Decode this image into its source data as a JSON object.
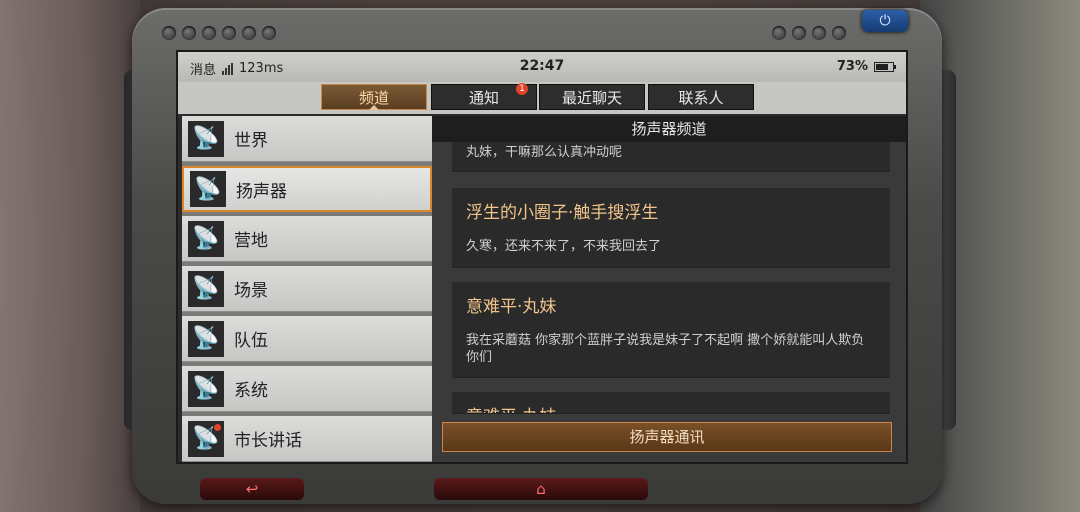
{
  "status_bar": {
    "left_label": "消息",
    "latency": "123ms",
    "time": "22:47",
    "battery": "73%"
  },
  "tabs": [
    {
      "label": "频道",
      "active": true
    },
    {
      "label": "通知",
      "badge": "1"
    },
    {
      "label": "最近聊天"
    },
    {
      "label": "联系人"
    }
  ],
  "channels": [
    {
      "label": "世界"
    },
    {
      "label": "扬声器",
      "active": true
    },
    {
      "label": "营地"
    },
    {
      "label": "场景"
    },
    {
      "label": "队伍"
    },
    {
      "label": "系统"
    },
    {
      "label": "市长讲话",
      "notification": true
    }
  ],
  "chat": {
    "title": "扬声器频道",
    "messages": [
      {
        "name": "",
        "text": "丸妹，干嘛那么认真冲动呢"
      },
      {
        "name": "浮生的小圈子·触手搜浮生",
        "text": "久寒，还来不来了，不来我回去了"
      },
      {
        "name": "意难平·丸妹",
        "text": "我在采蘑菇 你家那个蓝胖子说我是妹子了不起啊 撒个娇就能叫人欺负你们"
      },
      {
        "name": "意难平·丸妹",
        "text": ""
      }
    ],
    "send_button": "扬声器通讯"
  },
  "icons": {
    "channel": "satellite-dish-icon",
    "power": "power-icon",
    "back": "back-arrow-icon",
    "home": "home-icon"
  },
  "colors": {
    "accent": "#c9884a",
    "name_text": "#f0c48a",
    "badge": "#e2432a"
  }
}
